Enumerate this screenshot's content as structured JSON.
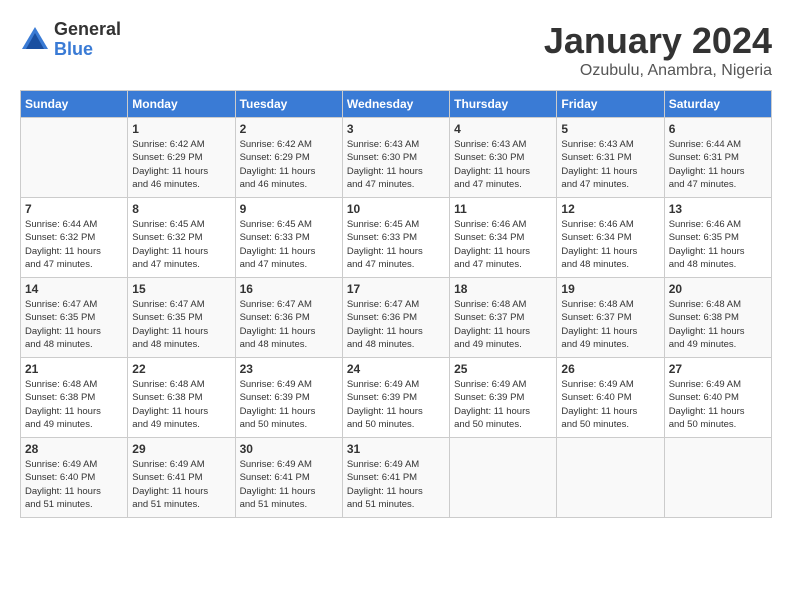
{
  "header": {
    "logo_general": "General",
    "logo_blue": "Blue",
    "month_title": "January 2024",
    "subtitle": "Ozubulu, Anambra, Nigeria"
  },
  "days_of_week": [
    "Sunday",
    "Monday",
    "Tuesday",
    "Wednesday",
    "Thursday",
    "Friday",
    "Saturday"
  ],
  "weeks": [
    [
      {
        "day": "",
        "info": ""
      },
      {
        "day": "1",
        "info": "Sunrise: 6:42 AM\nSunset: 6:29 PM\nDaylight: 11 hours\nand 46 minutes."
      },
      {
        "day": "2",
        "info": "Sunrise: 6:42 AM\nSunset: 6:29 PM\nDaylight: 11 hours\nand 46 minutes."
      },
      {
        "day": "3",
        "info": "Sunrise: 6:43 AM\nSunset: 6:30 PM\nDaylight: 11 hours\nand 47 minutes."
      },
      {
        "day": "4",
        "info": "Sunrise: 6:43 AM\nSunset: 6:30 PM\nDaylight: 11 hours\nand 47 minutes."
      },
      {
        "day": "5",
        "info": "Sunrise: 6:43 AM\nSunset: 6:31 PM\nDaylight: 11 hours\nand 47 minutes."
      },
      {
        "day": "6",
        "info": "Sunrise: 6:44 AM\nSunset: 6:31 PM\nDaylight: 11 hours\nand 47 minutes."
      }
    ],
    [
      {
        "day": "7",
        "info": "Sunrise: 6:44 AM\nSunset: 6:32 PM\nDaylight: 11 hours\nand 47 minutes."
      },
      {
        "day": "8",
        "info": "Sunrise: 6:45 AM\nSunset: 6:32 PM\nDaylight: 11 hours\nand 47 minutes."
      },
      {
        "day": "9",
        "info": "Sunrise: 6:45 AM\nSunset: 6:33 PM\nDaylight: 11 hours\nand 47 minutes."
      },
      {
        "day": "10",
        "info": "Sunrise: 6:45 AM\nSunset: 6:33 PM\nDaylight: 11 hours\nand 47 minutes."
      },
      {
        "day": "11",
        "info": "Sunrise: 6:46 AM\nSunset: 6:34 PM\nDaylight: 11 hours\nand 47 minutes."
      },
      {
        "day": "12",
        "info": "Sunrise: 6:46 AM\nSunset: 6:34 PM\nDaylight: 11 hours\nand 48 minutes."
      },
      {
        "day": "13",
        "info": "Sunrise: 6:46 AM\nSunset: 6:35 PM\nDaylight: 11 hours\nand 48 minutes."
      }
    ],
    [
      {
        "day": "14",
        "info": "Sunrise: 6:47 AM\nSunset: 6:35 PM\nDaylight: 11 hours\nand 48 minutes."
      },
      {
        "day": "15",
        "info": "Sunrise: 6:47 AM\nSunset: 6:35 PM\nDaylight: 11 hours\nand 48 minutes."
      },
      {
        "day": "16",
        "info": "Sunrise: 6:47 AM\nSunset: 6:36 PM\nDaylight: 11 hours\nand 48 minutes."
      },
      {
        "day": "17",
        "info": "Sunrise: 6:47 AM\nSunset: 6:36 PM\nDaylight: 11 hours\nand 48 minutes."
      },
      {
        "day": "18",
        "info": "Sunrise: 6:48 AM\nSunset: 6:37 PM\nDaylight: 11 hours\nand 49 minutes."
      },
      {
        "day": "19",
        "info": "Sunrise: 6:48 AM\nSunset: 6:37 PM\nDaylight: 11 hours\nand 49 minutes."
      },
      {
        "day": "20",
        "info": "Sunrise: 6:48 AM\nSunset: 6:38 PM\nDaylight: 11 hours\nand 49 minutes."
      }
    ],
    [
      {
        "day": "21",
        "info": "Sunrise: 6:48 AM\nSunset: 6:38 PM\nDaylight: 11 hours\nand 49 minutes."
      },
      {
        "day": "22",
        "info": "Sunrise: 6:48 AM\nSunset: 6:38 PM\nDaylight: 11 hours\nand 49 minutes."
      },
      {
        "day": "23",
        "info": "Sunrise: 6:49 AM\nSunset: 6:39 PM\nDaylight: 11 hours\nand 50 minutes."
      },
      {
        "day": "24",
        "info": "Sunrise: 6:49 AM\nSunset: 6:39 PM\nDaylight: 11 hours\nand 50 minutes."
      },
      {
        "day": "25",
        "info": "Sunrise: 6:49 AM\nSunset: 6:39 PM\nDaylight: 11 hours\nand 50 minutes."
      },
      {
        "day": "26",
        "info": "Sunrise: 6:49 AM\nSunset: 6:40 PM\nDaylight: 11 hours\nand 50 minutes."
      },
      {
        "day": "27",
        "info": "Sunrise: 6:49 AM\nSunset: 6:40 PM\nDaylight: 11 hours\nand 50 minutes."
      }
    ],
    [
      {
        "day": "28",
        "info": "Sunrise: 6:49 AM\nSunset: 6:40 PM\nDaylight: 11 hours\nand 51 minutes."
      },
      {
        "day": "29",
        "info": "Sunrise: 6:49 AM\nSunset: 6:41 PM\nDaylight: 11 hours\nand 51 minutes."
      },
      {
        "day": "30",
        "info": "Sunrise: 6:49 AM\nSunset: 6:41 PM\nDaylight: 11 hours\nand 51 minutes."
      },
      {
        "day": "31",
        "info": "Sunrise: 6:49 AM\nSunset: 6:41 PM\nDaylight: 11 hours\nand 51 minutes."
      },
      {
        "day": "",
        "info": ""
      },
      {
        "day": "",
        "info": ""
      },
      {
        "day": "",
        "info": ""
      }
    ]
  ]
}
